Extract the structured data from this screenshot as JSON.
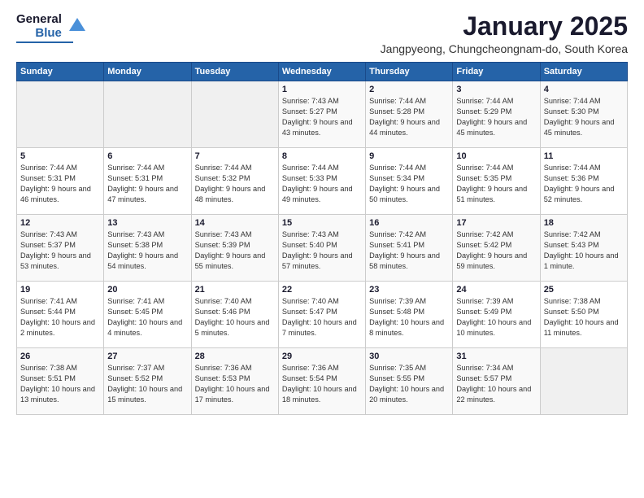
{
  "header": {
    "logo_general": "General",
    "logo_blue": "Blue",
    "month_title": "January 2025",
    "location": "Jangpyeong, Chungcheongnam-do, South Korea"
  },
  "weekdays": [
    "Sunday",
    "Monday",
    "Tuesday",
    "Wednesday",
    "Thursday",
    "Friday",
    "Saturday"
  ],
  "weeks": [
    {
      "row_class": "row-1",
      "days": [
        {
          "num": "",
          "info": "",
          "empty": true
        },
        {
          "num": "",
          "info": "",
          "empty": true
        },
        {
          "num": "",
          "info": "",
          "empty": true
        },
        {
          "num": "1",
          "info": "Sunrise: 7:43 AM\nSunset: 5:27 PM\nDaylight: 9 hours\nand 43 minutes."
        },
        {
          "num": "2",
          "info": "Sunrise: 7:44 AM\nSunset: 5:28 PM\nDaylight: 9 hours\nand 44 minutes."
        },
        {
          "num": "3",
          "info": "Sunrise: 7:44 AM\nSunset: 5:29 PM\nDaylight: 9 hours\nand 45 minutes."
        },
        {
          "num": "4",
          "info": "Sunrise: 7:44 AM\nSunset: 5:30 PM\nDaylight: 9 hours\nand 45 minutes."
        }
      ]
    },
    {
      "row_class": "row-2",
      "days": [
        {
          "num": "5",
          "info": "Sunrise: 7:44 AM\nSunset: 5:31 PM\nDaylight: 9 hours\nand 46 minutes."
        },
        {
          "num": "6",
          "info": "Sunrise: 7:44 AM\nSunset: 5:31 PM\nDaylight: 9 hours\nand 47 minutes."
        },
        {
          "num": "7",
          "info": "Sunrise: 7:44 AM\nSunset: 5:32 PM\nDaylight: 9 hours\nand 48 minutes."
        },
        {
          "num": "8",
          "info": "Sunrise: 7:44 AM\nSunset: 5:33 PM\nDaylight: 9 hours\nand 49 minutes."
        },
        {
          "num": "9",
          "info": "Sunrise: 7:44 AM\nSunset: 5:34 PM\nDaylight: 9 hours\nand 50 minutes."
        },
        {
          "num": "10",
          "info": "Sunrise: 7:44 AM\nSunset: 5:35 PM\nDaylight: 9 hours\nand 51 minutes."
        },
        {
          "num": "11",
          "info": "Sunrise: 7:44 AM\nSunset: 5:36 PM\nDaylight: 9 hours\nand 52 minutes."
        }
      ]
    },
    {
      "row_class": "row-3",
      "days": [
        {
          "num": "12",
          "info": "Sunrise: 7:43 AM\nSunset: 5:37 PM\nDaylight: 9 hours\nand 53 minutes."
        },
        {
          "num": "13",
          "info": "Sunrise: 7:43 AM\nSunset: 5:38 PM\nDaylight: 9 hours\nand 54 minutes."
        },
        {
          "num": "14",
          "info": "Sunrise: 7:43 AM\nSunset: 5:39 PM\nDaylight: 9 hours\nand 55 minutes."
        },
        {
          "num": "15",
          "info": "Sunrise: 7:43 AM\nSunset: 5:40 PM\nDaylight: 9 hours\nand 57 minutes."
        },
        {
          "num": "16",
          "info": "Sunrise: 7:42 AM\nSunset: 5:41 PM\nDaylight: 9 hours\nand 58 minutes."
        },
        {
          "num": "17",
          "info": "Sunrise: 7:42 AM\nSunset: 5:42 PM\nDaylight: 9 hours\nand 59 minutes."
        },
        {
          "num": "18",
          "info": "Sunrise: 7:42 AM\nSunset: 5:43 PM\nDaylight: 10 hours\nand 1 minute."
        }
      ]
    },
    {
      "row_class": "row-4",
      "days": [
        {
          "num": "19",
          "info": "Sunrise: 7:41 AM\nSunset: 5:44 PM\nDaylight: 10 hours\nand 2 minutes."
        },
        {
          "num": "20",
          "info": "Sunrise: 7:41 AM\nSunset: 5:45 PM\nDaylight: 10 hours\nand 4 minutes."
        },
        {
          "num": "21",
          "info": "Sunrise: 7:40 AM\nSunset: 5:46 PM\nDaylight: 10 hours\nand 5 minutes."
        },
        {
          "num": "22",
          "info": "Sunrise: 7:40 AM\nSunset: 5:47 PM\nDaylight: 10 hours\nand 7 minutes."
        },
        {
          "num": "23",
          "info": "Sunrise: 7:39 AM\nSunset: 5:48 PM\nDaylight: 10 hours\nand 8 minutes."
        },
        {
          "num": "24",
          "info": "Sunrise: 7:39 AM\nSunset: 5:49 PM\nDaylight: 10 hours\nand 10 minutes."
        },
        {
          "num": "25",
          "info": "Sunrise: 7:38 AM\nSunset: 5:50 PM\nDaylight: 10 hours\nand 11 minutes."
        }
      ]
    },
    {
      "row_class": "row-5",
      "days": [
        {
          "num": "26",
          "info": "Sunrise: 7:38 AM\nSunset: 5:51 PM\nDaylight: 10 hours\nand 13 minutes."
        },
        {
          "num": "27",
          "info": "Sunrise: 7:37 AM\nSunset: 5:52 PM\nDaylight: 10 hours\nand 15 minutes."
        },
        {
          "num": "28",
          "info": "Sunrise: 7:36 AM\nSunset: 5:53 PM\nDaylight: 10 hours\nand 17 minutes."
        },
        {
          "num": "29",
          "info": "Sunrise: 7:36 AM\nSunset: 5:54 PM\nDaylight: 10 hours\nand 18 minutes."
        },
        {
          "num": "30",
          "info": "Sunrise: 7:35 AM\nSunset: 5:55 PM\nDaylight: 10 hours\nand 20 minutes."
        },
        {
          "num": "31",
          "info": "Sunrise: 7:34 AM\nSunset: 5:57 PM\nDaylight: 10 hours\nand 22 minutes."
        },
        {
          "num": "",
          "info": "",
          "empty": true
        }
      ]
    }
  ]
}
